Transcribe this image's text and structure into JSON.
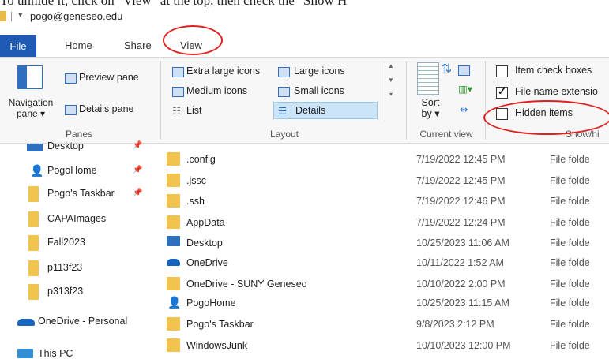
{
  "caption": "To unhide it, click on \"View\" at the top, then check the \"Show H",
  "window": {
    "title": "pogo@geneseo.edu",
    "qat_arrow": "▾"
  },
  "tabs": [
    {
      "label": "File"
    },
    {
      "label": "Home"
    },
    {
      "label": "Share"
    },
    {
      "label": "View"
    }
  ],
  "ribbon": {
    "panes": {
      "navigation_pane": "Navigation\npane ▾",
      "preview_pane": "Preview pane",
      "details_pane": "Details pane",
      "group_label": "Panes"
    },
    "layout": {
      "items": [
        "Extra large icons",
        "Large icons",
        "Medium icons",
        "Small icons",
        "List",
        "Details"
      ],
      "selected": "Details",
      "group_label": "Layout"
    },
    "current_view": {
      "sort_by": "Sort\nby ▾",
      "group_label": "Current view"
    },
    "show_hide": {
      "item_check_boxes": "Item check boxes",
      "file_name_extensions": "File name extensio",
      "hidden_items": "Hidden items",
      "item_check_boxes_checked": false,
      "file_name_extensions_checked": true,
      "hidden_items_checked": false,
      "group_label": "Show/hi"
    }
  },
  "nav_pane": [
    {
      "label": "Desktop",
      "icon": "desktop-icon",
      "pinned": true
    },
    {
      "label": "PogoHome",
      "icon": "user-icon",
      "pinned": true
    },
    {
      "label": "Pogo's Taskbar",
      "icon": "folder-icon",
      "pinned": true
    },
    {
      "label": "CAPAImages",
      "icon": "folder-icon",
      "pinned": false
    },
    {
      "label": "Fall2023",
      "icon": "folder-icon",
      "pinned": false
    },
    {
      "label": "p113f23",
      "icon": "folder-icon",
      "pinned": false
    },
    {
      "label": "p313f23",
      "icon": "folder-icon",
      "pinned": false
    },
    {
      "label": "OneDrive - Personal",
      "icon": "cloud-icon",
      "pinned": false
    },
    {
      "label": "This PC",
      "icon": "computer-icon",
      "pinned": false
    }
  ],
  "files": [
    {
      "name": ".config",
      "date": "7/19/2022 12:45 PM",
      "type": "File folde",
      "icon": "folder-icon"
    },
    {
      "name": ".jssc",
      "date": "7/19/2022 12:45 PM",
      "type": "File folde",
      "icon": "folder-icon"
    },
    {
      "name": ".ssh",
      "date": "7/19/2022 12:46 PM",
      "type": "File folde",
      "icon": "folder-icon"
    },
    {
      "name": "AppData",
      "date": "7/19/2022 12:24 PM",
      "type": "File folde",
      "icon": "folder-icon"
    },
    {
      "name": "Desktop",
      "date": "10/25/2023 11:06 AM",
      "type": "File folde",
      "icon": "desktop-icon"
    },
    {
      "name": "OneDrive",
      "date": "10/11/2022 1:52 AM",
      "type": "File folde",
      "icon": "cloud-icon"
    },
    {
      "name": "OneDrive - SUNY Geneseo",
      "date": "10/10/2022 2:00 PM",
      "type": "File folde",
      "icon": "folder-icon"
    },
    {
      "name": "PogoHome",
      "date": "10/25/2023 11:15 AM",
      "type": "File folde",
      "icon": "user-icon"
    },
    {
      "name": "Pogo's Taskbar",
      "date": "9/8/2023 2:12 PM",
      "type": "File folde",
      "icon": "folder-icon"
    },
    {
      "name": "WindowsJunk",
      "date": "10/10/2023 12:00 PM",
      "type": "File folde",
      "icon": "folder-icon"
    }
  ],
  "colors": {
    "accent": "#1f5bb5",
    "annotation": "#e02020",
    "folder": "#f0c24e",
    "selection": "#cce4f7"
  }
}
